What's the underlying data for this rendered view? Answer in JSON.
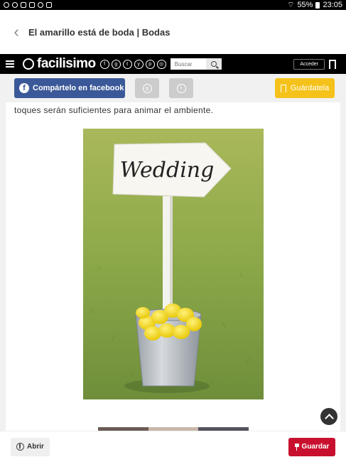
{
  "statusbar": {
    "battery": "55%",
    "time": "23:05"
  },
  "appbar": {
    "title": "El amarillo está de boda | Bodas"
  },
  "site": {
    "logo": "facilisimo",
    "search_placeholder": "Buscar",
    "login_label": "Acceder"
  },
  "share": {
    "facebook_label": "Compártelo en facebook",
    "save_label": "Guárdatela"
  },
  "article": {
    "intro": "toques serán suficientes para animar el ambiente.",
    "sign_text": "Wedding"
  },
  "bottom": {
    "open_label": "Abrir",
    "save_label": "Guardar"
  },
  "colors": {
    "facebook": "#3b5998",
    "save_yellow": "#f5c21b",
    "save_red": "#c8102e"
  }
}
